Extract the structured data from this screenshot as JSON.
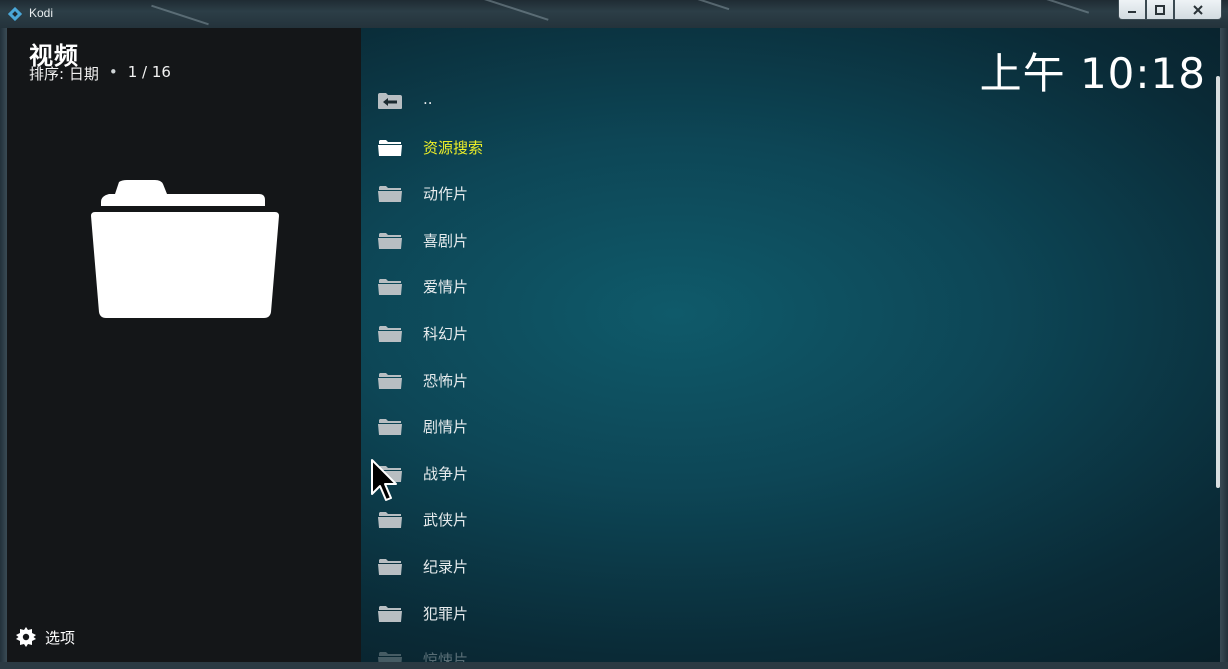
{
  "window": {
    "app_title": "Kodi"
  },
  "header": {
    "title": "视频",
    "sort_label": "排序: 日期",
    "position": "1 / 16",
    "clock": "上午 10:18"
  },
  "footer": {
    "options_label": "选项"
  },
  "list": {
    "items": [
      {
        "label": "..",
        "icon": "back-icon"
      },
      {
        "label": "资源搜索",
        "icon": "folder-icon",
        "focused": true
      },
      {
        "label": "动作片",
        "icon": "folder-icon"
      },
      {
        "label": "喜剧片",
        "icon": "folder-icon"
      },
      {
        "label": "爱情片",
        "icon": "folder-icon"
      },
      {
        "label": "科幻片",
        "icon": "folder-icon"
      },
      {
        "label": "恐怖片",
        "icon": "folder-icon"
      },
      {
        "label": "剧情片",
        "icon": "folder-icon"
      },
      {
        "label": "战争片",
        "icon": "folder-icon"
      },
      {
        "label": "武侠片",
        "icon": "folder-icon"
      },
      {
        "label": "纪录片",
        "icon": "folder-icon"
      },
      {
        "label": "犯罪片",
        "icon": "folder-icon"
      },
      {
        "label": "惊悚片",
        "icon": "folder-icon"
      }
    ]
  },
  "colors": {
    "focus_text": "#ecee28",
    "text": "#e8ecee",
    "left_panel": "#141618",
    "background_teal": "#0f5a6a"
  }
}
